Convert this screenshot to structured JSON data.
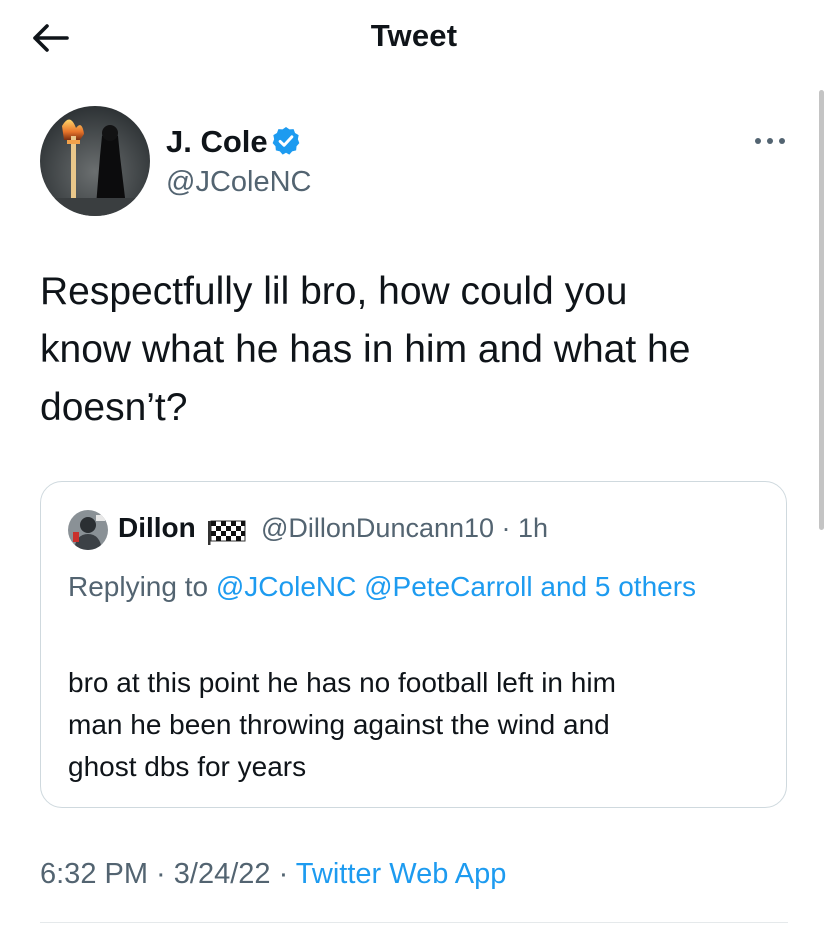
{
  "header": {
    "title": "Tweet",
    "back_icon": "arrow-left-icon"
  },
  "tweet": {
    "author": {
      "name": "J. Cole",
      "handle": "@JColeNC",
      "verified": true
    },
    "text": "Respectfully lil bro, how could you\nknow what he has in him and what he\ndoesn’t?",
    "timestamp": "6:32 PM · 3/24/22 · ",
    "source": "Twitter Web App"
  },
  "quote": {
    "author": {
      "name": "Dillon",
      "handle": "@DillonDuncann10",
      "time": " · 1h"
    },
    "replying_prefix": "Replying to ",
    "replying_handle_1": "@JColeNC",
    "replying_handle_2": " @PeteCarroll",
    "replying_others": " and 5 others",
    "text": "bro at this point he has no football left in him\nman he been throwing against the wind and\nghost dbs for years"
  },
  "colors": {
    "accent": "#1d9bf0",
    "text": "#0f1419",
    "muted": "#536471",
    "border": "#cfd9de"
  }
}
